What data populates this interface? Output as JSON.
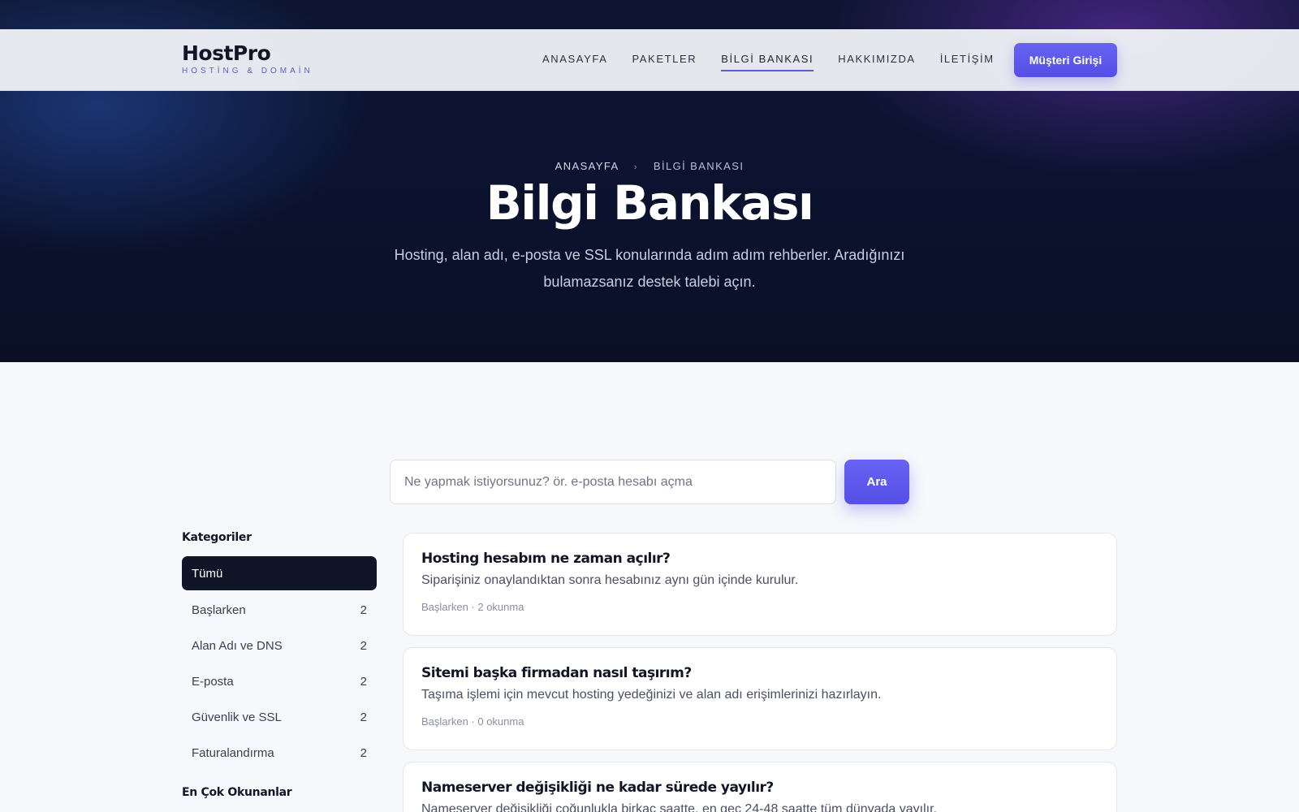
{
  "brand": {
    "name": "HostPro",
    "tagline": "HOSTİNG & DOMAİN"
  },
  "nav": {
    "links": [
      {
        "label": "ANASAYFA"
      },
      {
        "label": "PAKETLER"
      },
      {
        "label": "BİLGİ BANKASI"
      },
      {
        "label": "HAKKIMIZDA"
      },
      {
        "label": "İLETİŞİM"
      }
    ],
    "active": "BİLGİ BANKASI",
    "login_label": "Müşteri Girişi"
  },
  "breadcrumb": {
    "home": "ANASAYFA",
    "current": "BİLGİ BANKASI"
  },
  "hero": {
    "title": "Bilgi Bankası",
    "subtitle": "Hosting, alan adı, e-posta ve SSL konularında adım adım rehberler. Aradığınızı bulamazsanız destek talebi açın."
  },
  "search": {
    "placeholder": "Ne yapmak istiyorsunuz? ör. e-posta hesabı açma",
    "value": "",
    "button_label": "Ara"
  },
  "sidebar": {
    "categories_title": "Kategoriler",
    "categories": [
      {
        "label": "Tümü",
        "count": ""
      },
      {
        "label": "Başlarken",
        "count": "2"
      },
      {
        "label": "Alan Adı ve DNS",
        "count": "2"
      },
      {
        "label": "E-posta",
        "count": "2"
      },
      {
        "label": "Güvenlik ve SSL",
        "count": "2"
      },
      {
        "label": "Faturalandırma",
        "count": "2"
      }
    ],
    "popular_title": "En Çok Okunanlar"
  },
  "articles": [
    {
      "title": "Hosting hesabım ne zaman açılır?",
      "summary": "Siparişiniz onaylandıktan sonra hesabınız aynı gün içinde kurulur.",
      "meta": "Başlarken · 2 okunma"
    },
    {
      "title": "Sitemi başka firmadan nasıl taşırım?",
      "summary": "Taşıma işlemi için mevcut hosting yedeğinizi ve alan adı erişimlerinizi hazırlayın.",
      "meta": "Başlarken · 0 okunma"
    },
    {
      "title": "Nameserver değişikliği ne kadar sürede yayılır?",
      "summary": "Nameserver değişikliği çoğunlukla birkaç saatte, en geç 24-48 saatte tüm dünyada yayılır.",
      "meta": ""
    }
  ],
  "colors": {
    "accent": "#5b5fd6",
    "button": "#554fe6",
    "hero_dark": "#0a0f26",
    "active_category": "#0f1426"
  }
}
